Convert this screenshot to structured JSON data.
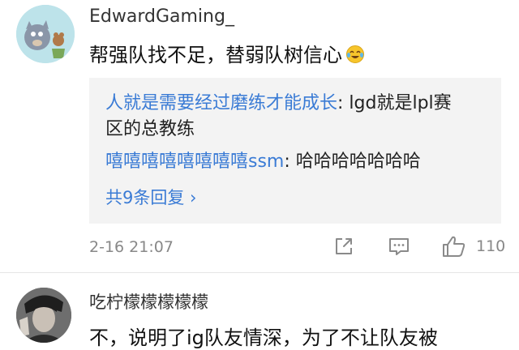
{
  "comments": [
    {
      "username": "EdwardGaming_",
      "text": "帮强队找不足，替弱队树信心",
      "emoji_icon": "laughing-crying-emoji-icon",
      "replies": [
        {
          "author": "人就是需要经过磨练才能成长",
          "separator": ": ",
          "text_line1": "lgd就是lpl赛",
          "text_line2": "区的总教练"
        },
        {
          "author": "嘻嘻嘻嘻嘻嘻嘻嘻ssm",
          "separator": ": ",
          "text_line1": "哈哈哈哈哈哈哈"
        }
      ],
      "more_replies": "共9条回复 ›",
      "timestamp": "2-16 21:07",
      "like_count": "110"
    },
    {
      "username": "吃柠檬檬檬檬檬",
      "text": "不，说明了ig队友情深，为了不让队友被"
    }
  ],
  "colors": {
    "link_blue": "#3a7bd5",
    "reply_bg": "#f3f3f3",
    "meta_gray": "#888888"
  }
}
